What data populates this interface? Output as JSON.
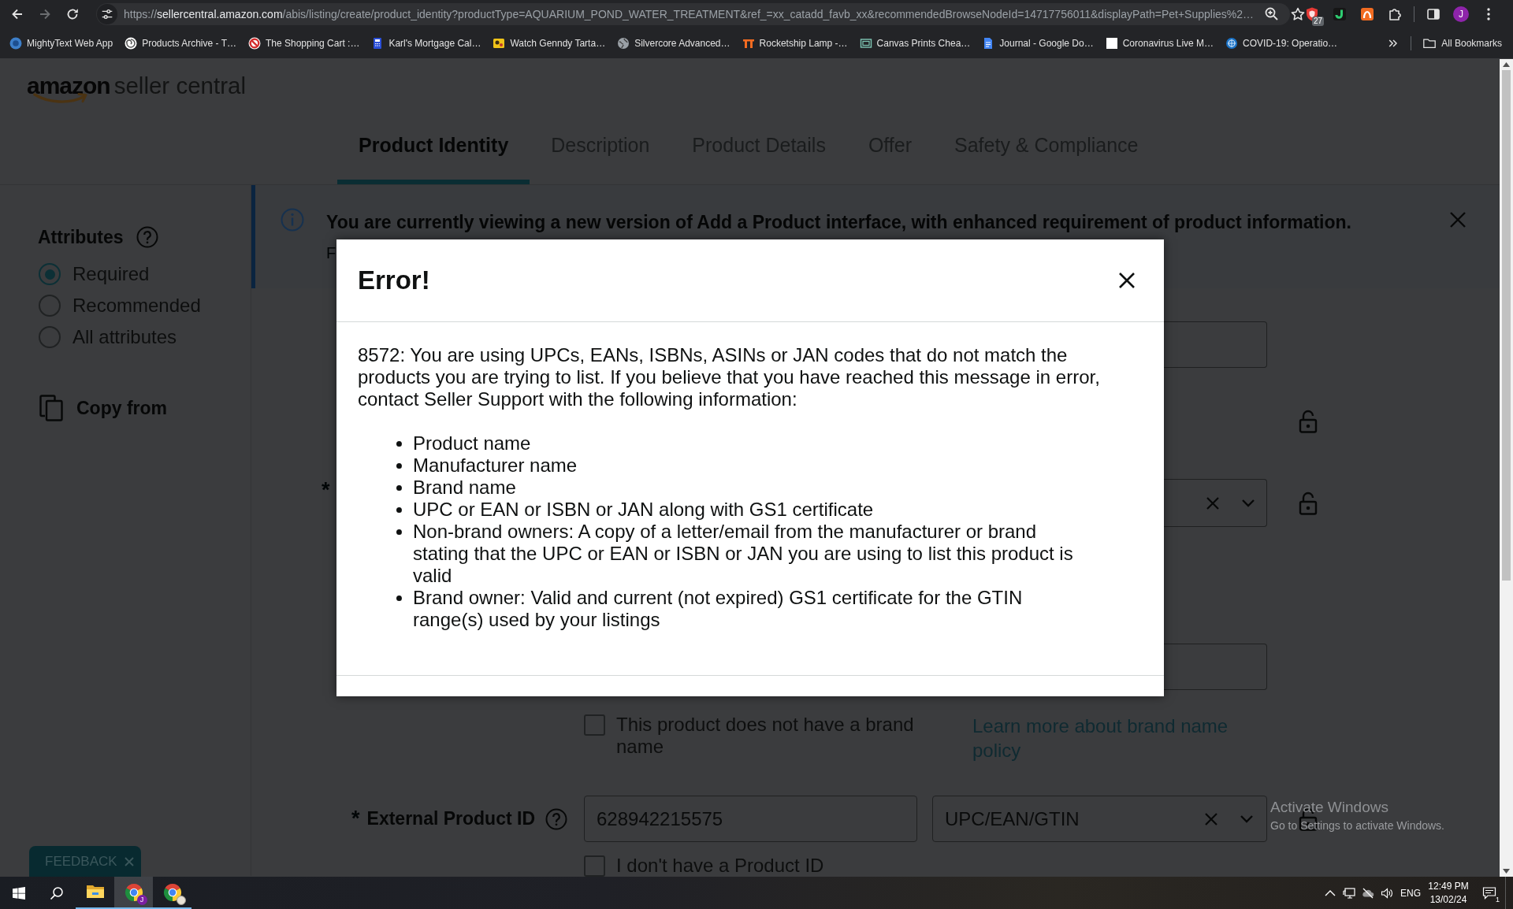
{
  "browser": {
    "nav": [
      {
        "kind": "back",
        "disabled": false
      },
      {
        "kind": "forward",
        "disabled": true
      },
      {
        "kind": "reload",
        "disabled": false
      }
    ],
    "url": {
      "scheme": "https://",
      "host": "sellercentral.amazon.com",
      "rest": "/abis/listing/create/product_identity?productType=AQUARIUM_POND_WATER_TREATMENT&ref_=xx_catadd_favb_xx&recommendedBrowseNodeId=14717756011&displayPath=Pet+Supplies%2…"
    },
    "extensions": [
      {
        "kind": "shield",
        "badge": "27"
      },
      {
        "kind": "hook"
      },
      {
        "kind": "tile"
      },
      {
        "kind": "puzzle"
      }
    ],
    "profile_initial": "J",
    "bookmarks": [
      {
        "kind": "disc",
        "label": "MightyText Web App"
      },
      {
        "kind": "swirl",
        "label": "Products Archive - T…"
      },
      {
        "kind": "prohibited",
        "label": "The Shopping Cart :…"
      },
      {
        "kind": "calculator",
        "label": "Karl's Mortgage Cal…"
      },
      {
        "kind": "tile",
        "label": "Watch Genndy Tarta…"
      },
      {
        "kind": "globe",
        "label": "Silvercore Advanced…"
      },
      {
        "kind": "arch",
        "label": "Rocketship Lamp -…"
      },
      {
        "kind": "frame",
        "label": "Canvas Prints Chea…"
      },
      {
        "kind": "document",
        "label": "Journal - Google Do…"
      },
      {
        "kind": "blank",
        "label": "Coronavirus Live M…"
      },
      {
        "kind": "emblem",
        "label": "COVID-19: Operatio…"
      }
    ],
    "all_bookmarks": "All Bookmarks"
  },
  "page": {
    "logo": {
      "brand": "amazon",
      "product": "seller central"
    },
    "tabs": [
      {
        "label": "Product Identity",
        "selected": true
      },
      {
        "label": "Description",
        "selected": false
      },
      {
        "label": "Product Details",
        "selected": false
      },
      {
        "label": "Offer",
        "selected": false
      },
      {
        "label": "Safety & Compliance",
        "selected": false
      }
    ],
    "sidebar": {
      "title": "Attributes",
      "filters": [
        {
          "label": "Required",
          "selected": true
        },
        {
          "label": "Recommended",
          "selected": false
        },
        {
          "label": "All attributes",
          "selected": false
        }
      ],
      "copy_from": "Copy from"
    },
    "banner": {
      "message": "You are currently viewing a new version of Add a Product interface, with enhanced requirement of product information.",
      "continuation": "F"
    },
    "form": {
      "rows": [
        {
          "kind": "input"
        },
        {
          "kind": "covered",
          "locked": true
        },
        {
          "kind": "select",
          "required_mark": "*",
          "locked": true
        },
        {
          "kind": "input"
        },
        {
          "kind": "checkbox",
          "checked": false,
          "label": "This product does not have a brand name",
          "link": "Learn more about brand name policy"
        },
        {
          "kind": "id_pair",
          "required_mark": "*",
          "label": "External Product ID",
          "value": "628942215575",
          "type_value": "UPC/EAN/GTIN",
          "locked": true
        },
        {
          "kind": "checkbox",
          "checked": false,
          "label": "I don't have a Product ID"
        }
      ]
    },
    "feedback": "FEEDBACK"
  },
  "modal": {
    "title": "Error!",
    "message": "8572: You are using UPCs, EANs, ISBNs, ASINs or JAN codes that do not match the products you are trying to list. If you believe that you have reached this message in error, contact Seller Support with the following information:",
    "bullets": [
      "Product name",
      "Manufacturer name",
      "Brand name",
      "UPC or EAN or ISBN or JAN along with GS1 certificate",
      "Non-brand owners: A copy of a letter/email from the manufacturer or brand stating that the UPC or EAN or ISBN or JAN you are using to list this product is valid",
      "Brand owner: Valid and current (not expired) GS1 certificate for the GTIN range(s) used by your listings"
    ]
  },
  "system_notice": {
    "title": "Activate Windows",
    "subtitle": "Go to Settings to activate Windows."
  },
  "taskbar": {
    "apps": [
      {
        "kind": "folder",
        "active": false
      },
      {
        "kind": "browser",
        "active": true,
        "badge": "J"
      },
      {
        "kind": "browser",
        "active": false,
        "profile_photo": true
      }
    ],
    "tray": {
      "language": "ENG",
      "time": "12:49 PM",
      "date": "13/02/24",
      "notifications": "1"
    }
  }
}
